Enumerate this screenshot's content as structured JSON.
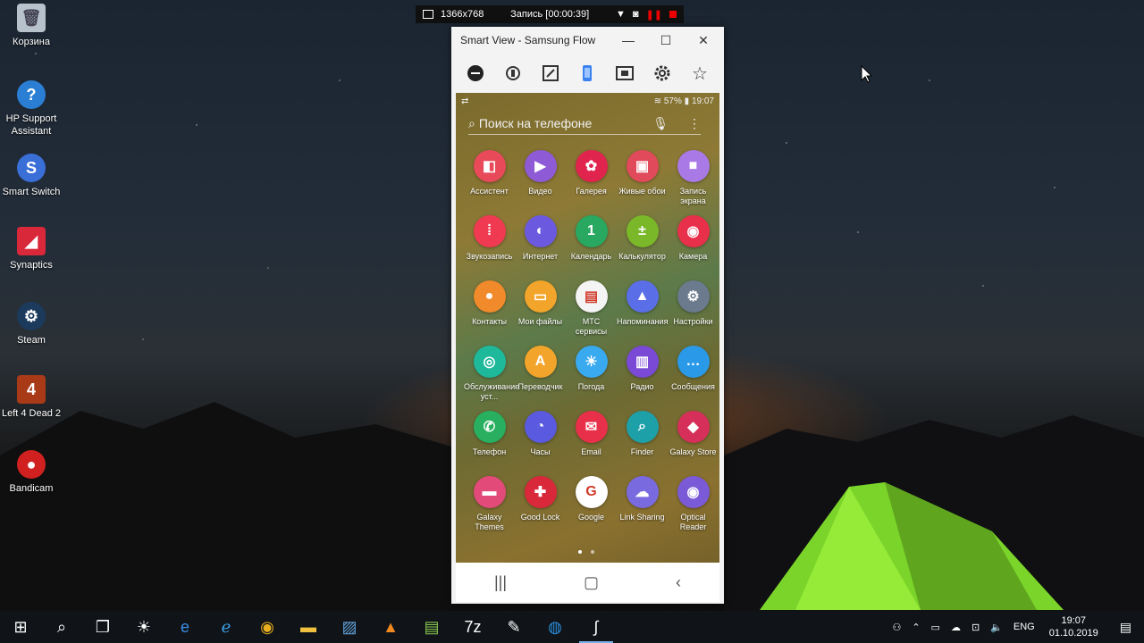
{
  "desktop": {
    "icons": [
      {
        "label": "Корзина",
        "icon": "recycle-bin-icon",
        "color": "#b8c2cc"
      },
      {
        "label": "HP Support Assistant",
        "icon": "hp-support-icon",
        "color": "#2a7fd4"
      },
      {
        "label": "Smart Switch",
        "icon": "smart-switch-icon",
        "color": "#3a6fd8"
      },
      {
        "label": "Synaptics",
        "icon": "synaptics-icon",
        "color": "#d8283a"
      },
      {
        "label": "Steam",
        "icon": "steam-icon",
        "color": "#1b3a5c"
      },
      {
        "label": "Left 4 Dead 2",
        "icon": "left4dead-icon",
        "color": "#a83a18"
      },
      {
        "label": "Bandicam",
        "icon": "bandicam-icon",
        "color": "#d02020"
      }
    ]
  },
  "recorder": {
    "resolution": "1366x768",
    "status": "Запись [00:00:39]"
  },
  "window": {
    "title": "Smart View - Samsung Flow",
    "toolbar": [
      "minus-icon",
      "rotate-icon",
      "expand-icon",
      "phone-icon",
      "screenshot-icon",
      "gear-icon",
      "star-icon"
    ]
  },
  "phone": {
    "status_battery": "57%",
    "status_time": "19:07",
    "search_placeholder": "Поиск на телефоне",
    "apps": [
      {
        "name": "Ассистент",
        "color": "#e94a5a",
        "glyph": "◧"
      },
      {
        "name": "Видео",
        "color": "#8e5ad6",
        "glyph": "▶"
      },
      {
        "name": "Галерея",
        "color": "#e0244e",
        "glyph": "✿"
      },
      {
        "name": "Живые обои",
        "color": "#e04a5a",
        "glyph": "▣"
      },
      {
        "name": "Запись экрана",
        "color": "#a97ae6",
        "glyph": "■"
      },
      {
        "name": "Звукозапись",
        "color": "#ef3a52",
        "glyph": "⦙"
      },
      {
        "name": "Интернет",
        "color": "#6b5ae0",
        "glyph": "◐"
      },
      {
        "name": "Календарь",
        "color": "#28a860",
        "glyph": "1"
      },
      {
        "name": "Калькулятор",
        "color": "#7ab82a",
        "glyph": "±"
      },
      {
        "name": "Камера",
        "color": "#e8304a",
        "glyph": "◉"
      },
      {
        "name": "Контакты",
        "color": "#f08a2a",
        "glyph": "●"
      },
      {
        "name": "Мои файлы",
        "color": "#f2a52a",
        "glyph": "▭"
      },
      {
        "name": "МТС сервисы",
        "color": "#f4f4f4",
        "glyph": "▤"
      },
      {
        "name": "Напоминания",
        "color": "#5a6ee8",
        "glyph": "▲"
      },
      {
        "name": "Настройки",
        "color": "#6b7a8c",
        "glyph": "⚙"
      },
      {
        "name": "Обслуживание уст...",
        "color": "#1eb89a",
        "glyph": "◎"
      },
      {
        "name": "Переводчик",
        "color": "#f2a52a",
        "glyph": "A"
      },
      {
        "name": "Погода",
        "color": "#3aaaf0",
        "glyph": "☀"
      },
      {
        "name": "Радио",
        "color": "#7a4ad6",
        "glyph": "▥"
      },
      {
        "name": "Сообщения",
        "color": "#2a9ae8",
        "glyph": "…"
      },
      {
        "name": "Телефон",
        "color": "#28b060",
        "glyph": "✆"
      },
      {
        "name": "Часы",
        "color": "#5a5ae0",
        "glyph": "◔"
      },
      {
        "name": "Email",
        "color": "#e8304a",
        "glyph": "✉"
      },
      {
        "name": "Finder",
        "color": "#1ea0a8",
        "glyph": "⌕"
      },
      {
        "name": "Galaxy Store",
        "color": "#d6305a",
        "glyph": "◆"
      },
      {
        "name": "Galaxy Themes",
        "color": "#e24a7a",
        "glyph": "▬"
      },
      {
        "name": "Good Lock",
        "color": "#d8283a",
        "glyph": "✚"
      },
      {
        "name": "Google",
        "color": "#ffffff",
        "glyph": "G"
      },
      {
        "name": "Link Sharing",
        "color": "#7a6ae0",
        "glyph": "☁"
      },
      {
        "name": "Optical Reader",
        "color": "#7a5ad6",
        "glyph": "◉"
      }
    ]
  },
  "taskbar": {
    "items": [
      "windows-start-icon",
      "search-icon",
      "task-view-icon",
      "brightness-icon",
      "edge-icon",
      "internet-explorer-icon",
      "chrome-icon",
      "file-explorer-icon",
      "photos-icon",
      "vlc-icon",
      "notepad-icon",
      "7zip-icon",
      "paint-icon",
      "hp-icon",
      "samsung-flow-icon"
    ],
    "lang": "ENG",
    "time": "19:07",
    "date": "01.10.2019"
  }
}
